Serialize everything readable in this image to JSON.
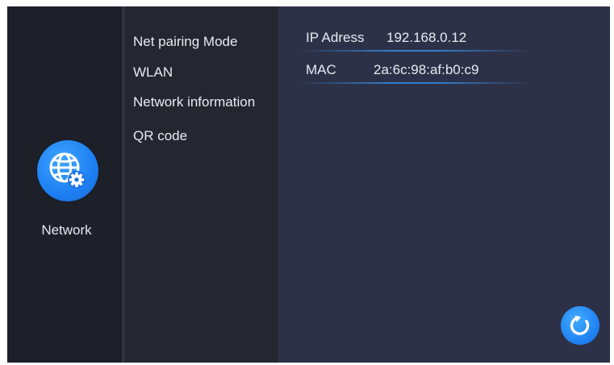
{
  "sidebar": {
    "active_section_label": "Network",
    "icon": "network-globe-gear-icon"
  },
  "menu": {
    "items": [
      {
        "label": "Net pairing Mode"
      },
      {
        "label": "WLAN"
      },
      {
        "label": "Network information"
      },
      {
        "label": "QR code"
      }
    ]
  },
  "network_info": {
    "ip": {
      "label": "IP Adress",
      "value": "192.168.0.12"
    },
    "mac": {
      "label": "MAC",
      "value": "2a:6c:98:af:b0:c9"
    }
  },
  "actions": {
    "refresh_icon": "refresh-icon"
  },
  "colors": {
    "accent": "#1e7ff2",
    "left_panel": "#1d2029",
    "menu_panel": "#24272f",
    "content_panel": "#2d3147",
    "text": "#e9ebf0"
  }
}
